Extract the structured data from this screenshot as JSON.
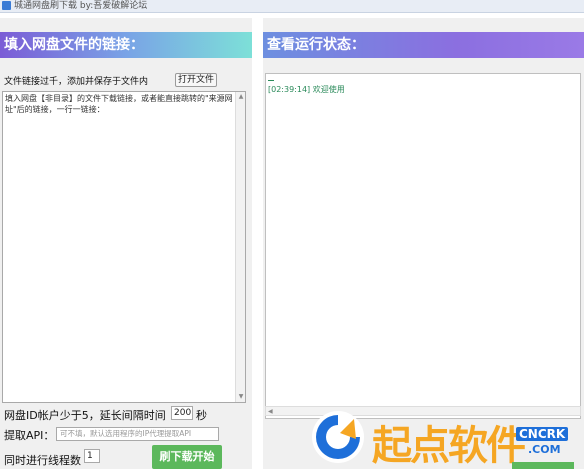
{
  "window": {
    "title": "城通网盘刷下载 by:吾爱破解论坛"
  },
  "left": {
    "header": "填入网盘文件的链接：",
    "hint": "文件链接过千，添加并保存于文件内",
    "open_file_button": "打开文件",
    "textarea_placeholder": "填入网盘【非目录】的文件下载链接，或者能直接跳转的\"来源网址\"后的链接，一行一链接：",
    "delay": {
      "label_before": "网盘ID帐户少于5，延长间隔时间",
      "value": "200",
      "unit": "秒"
    },
    "api": {
      "label": "提取API：",
      "placeholder": "可不填，默认选用程序的IP代理提取API"
    },
    "threads": {
      "label": "同时进行线程数",
      "value": "1"
    },
    "start_button": "刷下载开始"
  },
  "right": {
    "header": "查看运行状态：",
    "log": [
      "[02:39:14] 欢迎使用"
    ]
  },
  "watermark": {
    "brand": "起点软件",
    "badge": "CNCRK",
    "domain": ".COM"
  },
  "colors": {
    "start_button": "#5cb85c",
    "log_text": "#2a8a5a",
    "watermark_orange": "#f5a623",
    "watermark_blue": "#1e6fd9"
  }
}
